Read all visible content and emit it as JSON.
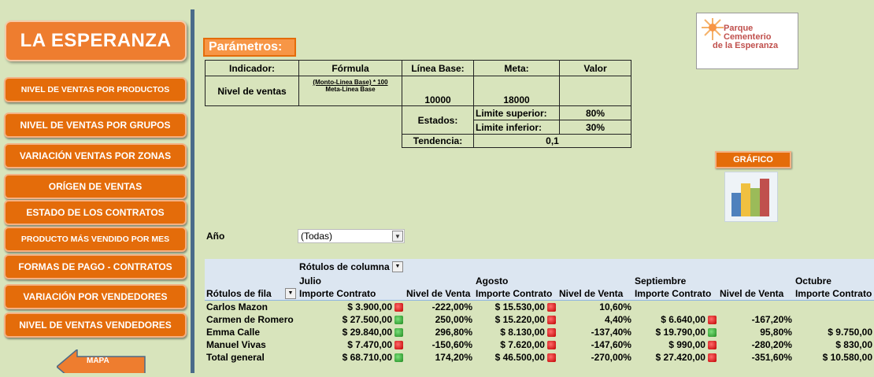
{
  "sidebar": {
    "title": "LA ESPERANZA",
    "items": [
      {
        "label": "NIVEL DE VENTAS POR PRODUCTOS"
      },
      {
        "label": "NIVEL DE VENTAS POR GRUPOS"
      },
      {
        "label": "VARIACIÓN VENTAS POR ZONAS"
      },
      {
        "label": "ORÍGEN DE VENTAS"
      },
      {
        "label": "ESTADO DE LOS CONTRATOS"
      },
      {
        "label": "PRODUCTO MÁS VENDIDO POR MES"
      },
      {
        "label": "FORMAS DE PAGO -  CONTRATOS"
      },
      {
        "label": "VARIACIÓN POR VENDEDORES"
      },
      {
        "label": "NIVEL DE VENTAS VENDEDORES"
      }
    ],
    "map_label": "MAPA"
  },
  "params": {
    "title": "Parámetros:",
    "headers": {
      "indicador": "Indicador:",
      "formula": "Fórmula",
      "linea_base": "Línea Base:",
      "meta": "Meta:",
      "valor": "Valor"
    },
    "indicator_name": "Nivel de ventas",
    "formula_num": "(Monto-Linea Base) * 100",
    "formula_den": "Meta-Linea Base",
    "linea_base_value": "10000",
    "meta_value": "18000",
    "estados_label": "Estados:",
    "limite_superior_label": "Limite superior:",
    "limite_superior_value": "80%",
    "limite_inferior_label": "Limite inferior:",
    "limite_inferior_value": "30%",
    "tendencia_label": "Tendencia:",
    "tendencia_value": "0,1"
  },
  "logo": {
    "line1": "Parque",
    "line2": "Cementerio",
    "line3": "de la Esperanza"
  },
  "grafico_label": "GRÁFICO",
  "filter": {
    "label": "Año",
    "value": "(Todas)"
  },
  "pivot": {
    "col_labels": "Rótulos de columna",
    "row_labels": "Rótulos de fila",
    "months": [
      "Julio",
      "Agosto",
      "Septiembre",
      "Octubre"
    ],
    "importe_header": "Importe Contrato",
    "nivel_header": "Nivel de Venta",
    "rows": [
      {
        "name": "Carlos Mazon",
        "c1": "$ 3.900,00",
        "l1": "red",
        "n1": "-222,00%",
        "c2": "$ 15.530,00",
        "l2": "red",
        "n2": "10,60%",
        "c3": "",
        "l3": "",
        "n3": "",
        "c4": ""
      },
      {
        "name": "Carmen de Romero",
        "c1": "$ 27.500,00",
        "l1": "green",
        "n1": "250,00%",
        "c2": "$ 15.220,00",
        "l2": "red",
        "n2": "4,40%",
        "c3": "$ 6.640,00",
        "l3": "red",
        "n3": "-167,20%",
        "c4": ""
      },
      {
        "name": "Emma Calle",
        "c1": "$ 29.840,00",
        "l1": "green",
        "n1": "296,80%",
        "c2": "$ 8.130,00",
        "l2": "red",
        "n2": "-137,40%",
        "c3": "$ 19.790,00",
        "l3": "green",
        "n3": "95,80%",
        "c4": "$ 9.750,00"
      },
      {
        "name": "Manuel Vivas",
        "c1": "$ 7.470,00",
        "l1": "red",
        "n1": "-150,60%",
        "c2": "$ 7.620,00",
        "l2": "red",
        "n2": "-147,60%",
        "c3": "$ 990,00",
        "l3": "red",
        "n3": "-280,20%",
        "c4": "$ 830,00"
      },
      {
        "name": "Total general",
        "c1": "$ 68.710,00",
        "l1": "green",
        "n1": "174,20%",
        "c2": "$ 46.500,00",
        "l2": "red",
        "n2": "-270,00%",
        "c3": "$ 27.420,00",
        "l3": "red",
        "n3": "-351,60%",
        "c4": "$ 10.580,00"
      }
    ]
  }
}
